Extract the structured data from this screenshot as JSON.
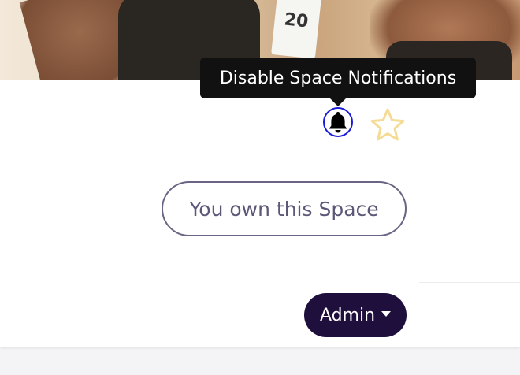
{
  "banner": {
    "bib_number": "20"
  },
  "tooltip": {
    "text": "Disable Space Notifications"
  },
  "icons": {
    "bell": "bell-icon",
    "star": "star-outline-icon"
  },
  "colors": {
    "bell_focus_ring": "#1a1ad9",
    "star_outline": "#f5dc96",
    "pill_border": "#6b6583",
    "admin_bg": "#1e0f3d"
  },
  "ownership": {
    "label": "You own this Space"
  },
  "admin": {
    "label": "Admin"
  }
}
